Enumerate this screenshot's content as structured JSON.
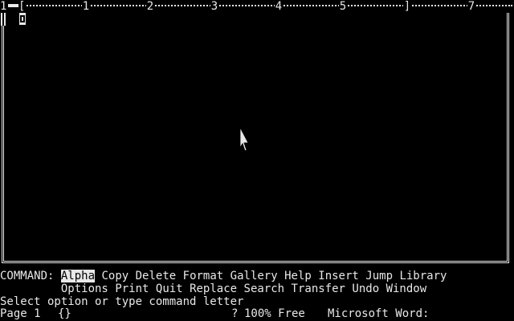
{
  "ruler": {
    "window_number": "1",
    "marks": [
      "1",
      "2",
      "3",
      "4",
      "5",
      "]",
      "7"
    ]
  },
  "command": {
    "label": "COMMAND:",
    "row1": [
      "Alpha",
      "Copy",
      "Delete",
      "Format",
      "Gallery",
      "Help",
      "Insert",
      "Jump",
      "Library"
    ],
    "row2": [
      "Options",
      "Print",
      "Quit",
      "Replace",
      "Search",
      "Transfer",
      "Undo",
      "Window"
    ],
    "selected": "Alpha"
  },
  "message": "Select option or type command letter",
  "status": {
    "page": "Page 1",
    "scrap": "{}",
    "help_mark": "?",
    "free": "100% Free",
    "app_name": "Microsoft Word:"
  }
}
